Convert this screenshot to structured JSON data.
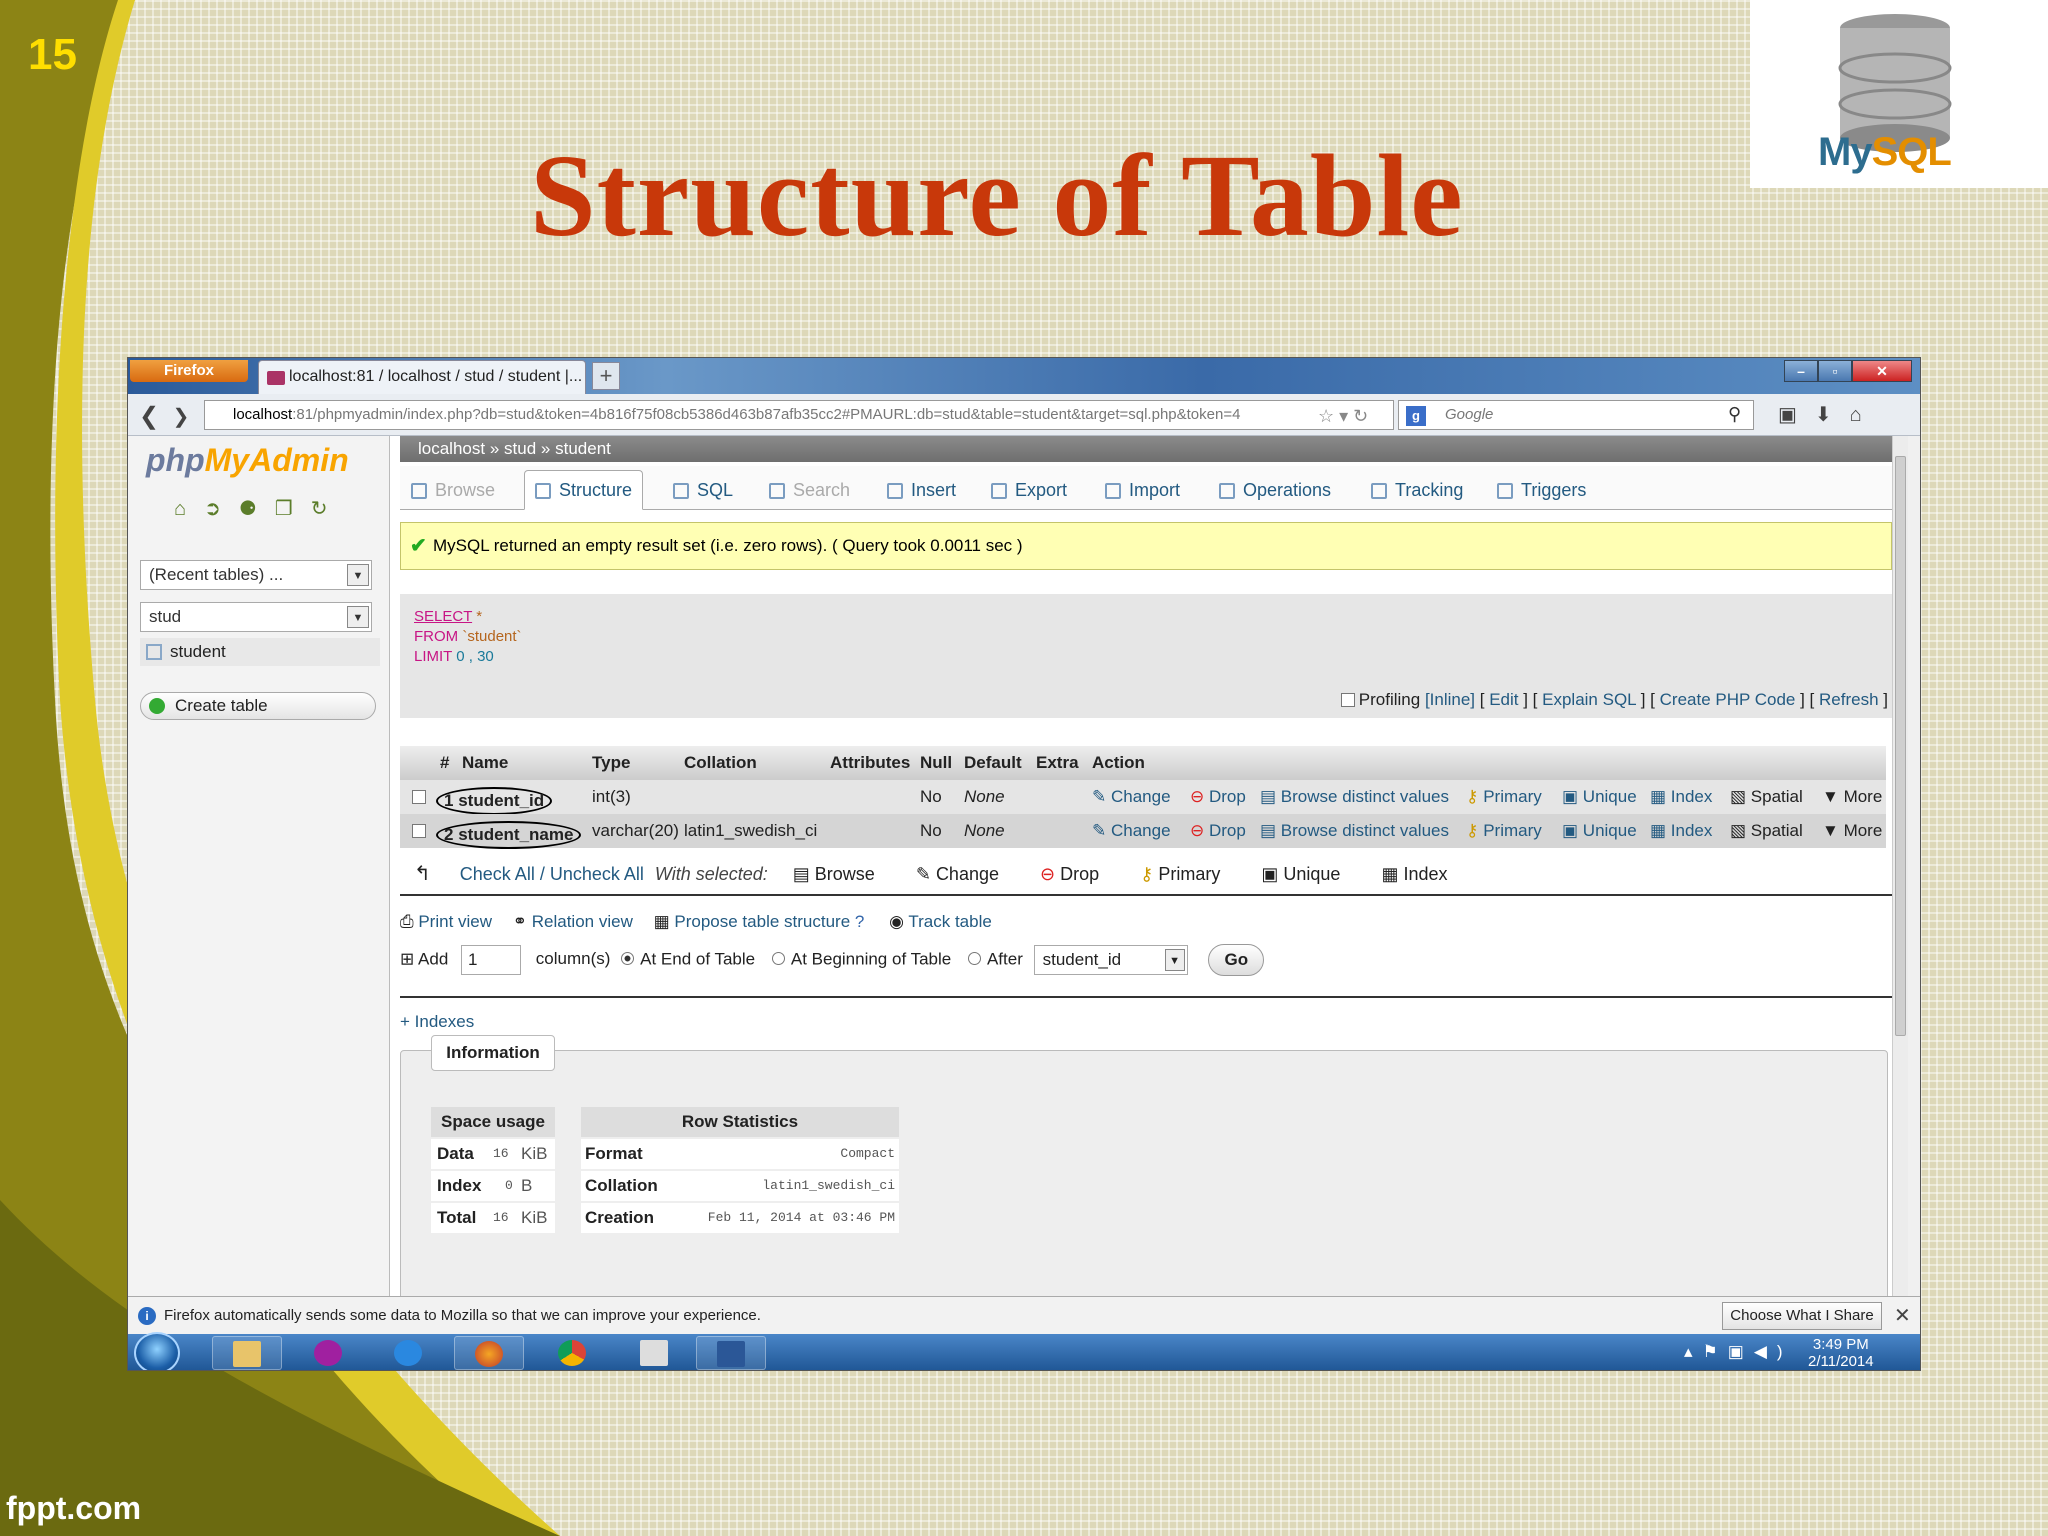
{
  "slide": {
    "number": "15",
    "title": "Structure of Table",
    "footer": "fppt.com",
    "logo_text_a": "My",
    "logo_text_b": "SQL"
  },
  "browser": {
    "menu_button": "Firefox",
    "tab_title": "localhost:81 / localhost / stud / student |...",
    "url_host": "localhost",
    "url_rest": ":81/phpmyadmin/index.php?db=stud&token=4b816f75f08cb5386d463b87afb35cc2#PMAURL:db=stud&table=student&target=sql.php&token=4",
    "search_placeholder": "Google",
    "notification": "Firefox automatically sends some data to Mozilla so that we can improve your experience.",
    "notification_button": "Choose What I Share"
  },
  "sidebar": {
    "logo_a": "php",
    "logo_b": "MyAdmin",
    "recent_tables": "(Recent tables) ...",
    "database": "stud",
    "table_item": "student",
    "create_table": "Create table"
  },
  "breadcrumb": {
    "server": "localhost",
    "db": "stud",
    "table": "student",
    "sep": "»"
  },
  "tabs": [
    {
      "label": "Browse"
    },
    {
      "label": "Structure"
    },
    {
      "label": "SQL"
    },
    {
      "label": "Search"
    },
    {
      "label": "Insert"
    },
    {
      "label": "Export"
    },
    {
      "label": "Import"
    },
    {
      "label": "Operations"
    },
    {
      "label": "Tracking"
    },
    {
      "label": "Triggers"
    }
  ],
  "message": "MySQL returned an empty result set (i.e. zero rows). ( Query took 0.0011 sec )",
  "sql": {
    "kw1": "SELECT",
    "v1": "*",
    "kw2": "FROM",
    "v2": "`student`",
    "kw3": "LIMIT",
    "v3": "0 , 30",
    "profiling": "Profiling",
    "links": [
      "[Inline]",
      "Edit",
      "Explain SQL",
      "Create PHP Code",
      "Refresh"
    ]
  },
  "table": {
    "headers": [
      "#",
      "Name",
      "Type",
      "Collation",
      "Attributes",
      "Null",
      "Default",
      "Extra",
      "Action"
    ],
    "rows": [
      {
        "num": "1",
        "name": "student_id",
        "type": "int(3)",
        "collation": "",
        "null": "No",
        "default": "None"
      },
      {
        "num": "2",
        "name": "student_name",
        "type": "varchar(20)",
        "collation": "latin1_swedish_ci",
        "null": "No",
        "default": "None"
      }
    ],
    "actions": [
      "Change",
      "Drop",
      "Browse distinct values",
      "Primary",
      "Unique",
      "Index",
      "Spatial",
      "More"
    ]
  },
  "with_selected": {
    "check_all": "Check All / Uncheck All",
    "label": "With selected:",
    "items": [
      "Browse",
      "Change",
      "Drop",
      "Primary",
      "Unique",
      "Index"
    ]
  },
  "tools": [
    "Print view",
    "Relation view",
    "Propose table structure",
    "Track table"
  ],
  "add_column": {
    "add": "Add",
    "count": "1",
    "columns": "column(s)",
    "end": "At End of Table",
    "begin": "At Beginning of Table",
    "after": "After",
    "after_field": "student_id",
    "go": "Go"
  },
  "indexes": "+ Indexes",
  "info": {
    "tab": "Information",
    "space_usage": "Space usage",
    "space_rows": [
      {
        "label": "Data",
        "value": "16",
        "unit": "KiB"
      },
      {
        "label": "Index",
        "value": "0",
        "unit": "B"
      },
      {
        "label": "Total",
        "value": "16",
        "unit": "KiB"
      }
    ],
    "row_stats": "Row Statistics",
    "stat_rows": [
      {
        "label": "Format",
        "value": "Compact"
      },
      {
        "label": "Collation",
        "value": "latin1_swedish_ci"
      },
      {
        "label": "Creation",
        "value": "Feb 11, 2014 at 03:46 PM"
      }
    ]
  },
  "taskbar": {
    "time": "3:49 PM",
    "date": "2/11/2014"
  }
}
